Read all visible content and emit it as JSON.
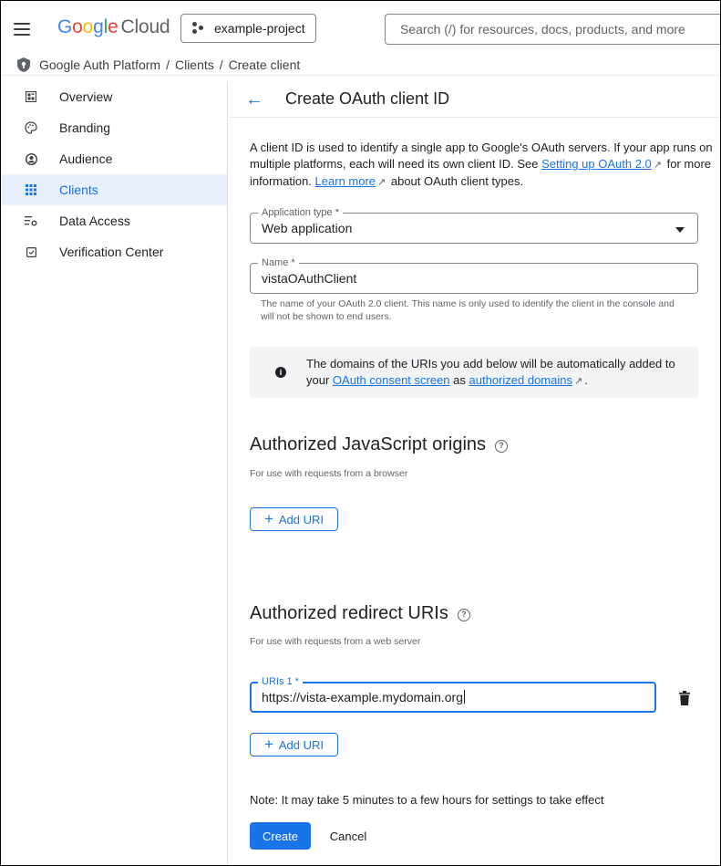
{
  "topbar": {
    "logo_parts": [
      "G",
      "o",
      "o",
      "g",
      "l",
      "e"
    ],
    "logo_product": "Cloud",
    "project_name": "example-project",
    "search_placeholder": "Search (/) for resources, docs, products, and more"
  },
  "breadcrumb": {
    "items": [
      "Google Auth Platform",
      "Clients",
      "Create client"
    ],
    "separator": "/"
  },
  "sidebar": {
    "items": [
      {
        "label": "Overview",
        "icon": "dashboard-icon",
        "active": false
      },
      {
        "label": "Branding",
        "icon": "palette-icon",
        "active": false
      },
      {
        "label": "Audience",
        "icon": "person-circle-icon",
        "active": false
      },
      {
        "label": "Clients",
        "icon": "grid-dots-icon",
        "active": true
      },
      {
        "label": "Data Access",
        "icon": "data-settings-icon",
        "active": false
      },
      {
        "label": "Verification Center",
        "icon": "checkbox-icon",
        "active": false
      }
    ]
  },
  "main": {
    "title": "Create OAuth client ID",
    "description": {
      "text1": "A client ID is used to identify a single app to Google's OAuth servers. If your app runs on multiple platforms, each will need its own client ID. See ",
      "link1": "Setting up OAuth 2.0",
      "text2": " for more information. ",
      "link2": "Learn more",
      "text3": " about OAuth client types."
    },
    "application_type": {
      "label": "Application type *",
      "value": "Web application"
    },
    "name_field": {
      "label": "Name *",
      "value": "vistaOAuthClient",
      "hint": "The name of your OAuth 2.0 client. This name is only used to identify the client in the console and will not be shown to end users."
    },
    "info": {
      "text1": "The domains of the URIs you add below will be automatically added to your ",
      "link1": "OAuth consent screen",
      "text2": " as ",
      "link2": "authorized domains",
      "text3": "."
    },
    "js_origins": {
      "title": "Authorized JavaScript origins",
      "subtitle": "For use with requests from a browser",
      "add_label": "Add URI"
    },
    "redirect_uris": {
      "title": "Authorized redirect URIs",
      "subtitle": "For use with requests from a web server",
      "field_label": "URIs 1 *",
      "field_value": "https://vista-example.mydomain.org",
      "add_label": "Add URI"
    },
    "note": "Note: It may take 5 minutes to a few hours for settings to take effect",
    "create_label": "Create",
    "cancel_label": "Cancel"
  },
  "colors": {
    "accent": "#1a73e8",
    "active_bg": "#e8f0fe",
    "info_bg": "#f1f3f4"
  }
}
